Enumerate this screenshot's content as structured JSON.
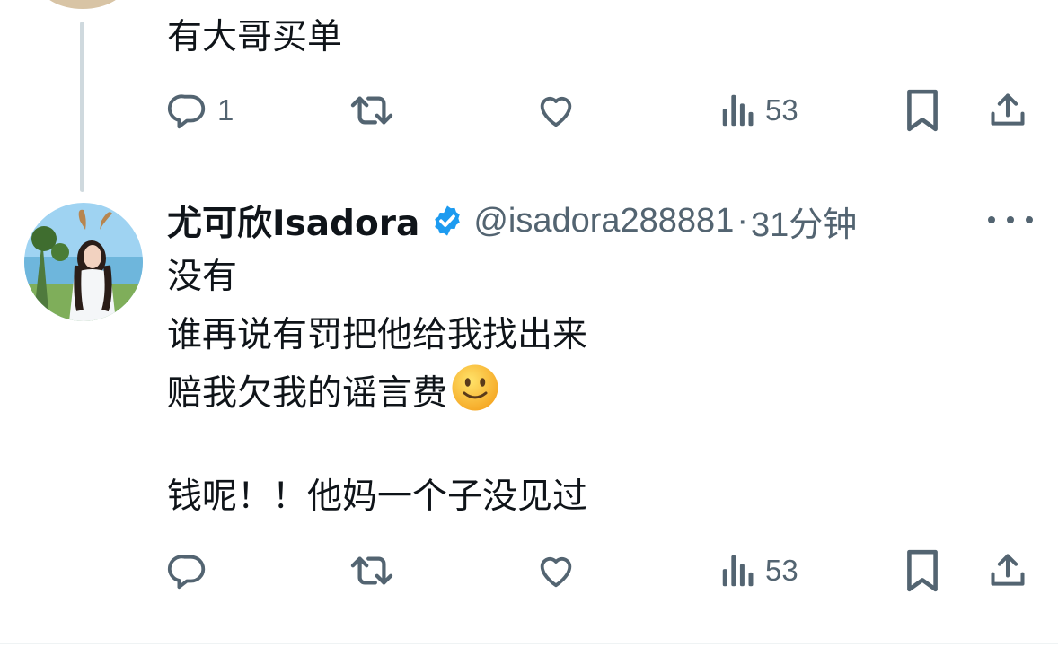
{
  "previous_tweet": {
    "text": "有大哥买单",
    "actions": {
      "reply_count": "1",
      "repost_count": "",
      "like_count": "",
      "views_count": "53"
    }
  },
  "tweet": {
    "author": {
      "display_name": "尤可欣Isadora",
      "handle": "@isadora288881",
      "verified": true,
      "verified_color": "#1d9bf0"
    },
    "separator": "·",
    "timestamp": "31分钟",
    "lines": [
      "没有",
      "谁再说有罚把他给我找出来",
      "赔我欠我的谣言费",
      "",
      "钱呢！！他妈一个子没见过"
    ],
    "emoji": "slightly-smiling-face",
    "actions": {
      "reply_count": "",
      "repost_count": "",
      "like_count": "",
      "views_count": "53"
    }
  },
  "colors": {
    "text_primary": "#0f1419",
    "text_secondary": "#536471",
    "thread_line": "#cfd9de",
    "verified_blue": "#1d9bf0"
  },
  "icons": [
    "reply-icon",
    "repost-icon",
    "like-icon",
    "views-icon",
    "bookmark-icon",
    "share-icon",
    "more-icon",
    "verified-badge-icon"
  ]
}
